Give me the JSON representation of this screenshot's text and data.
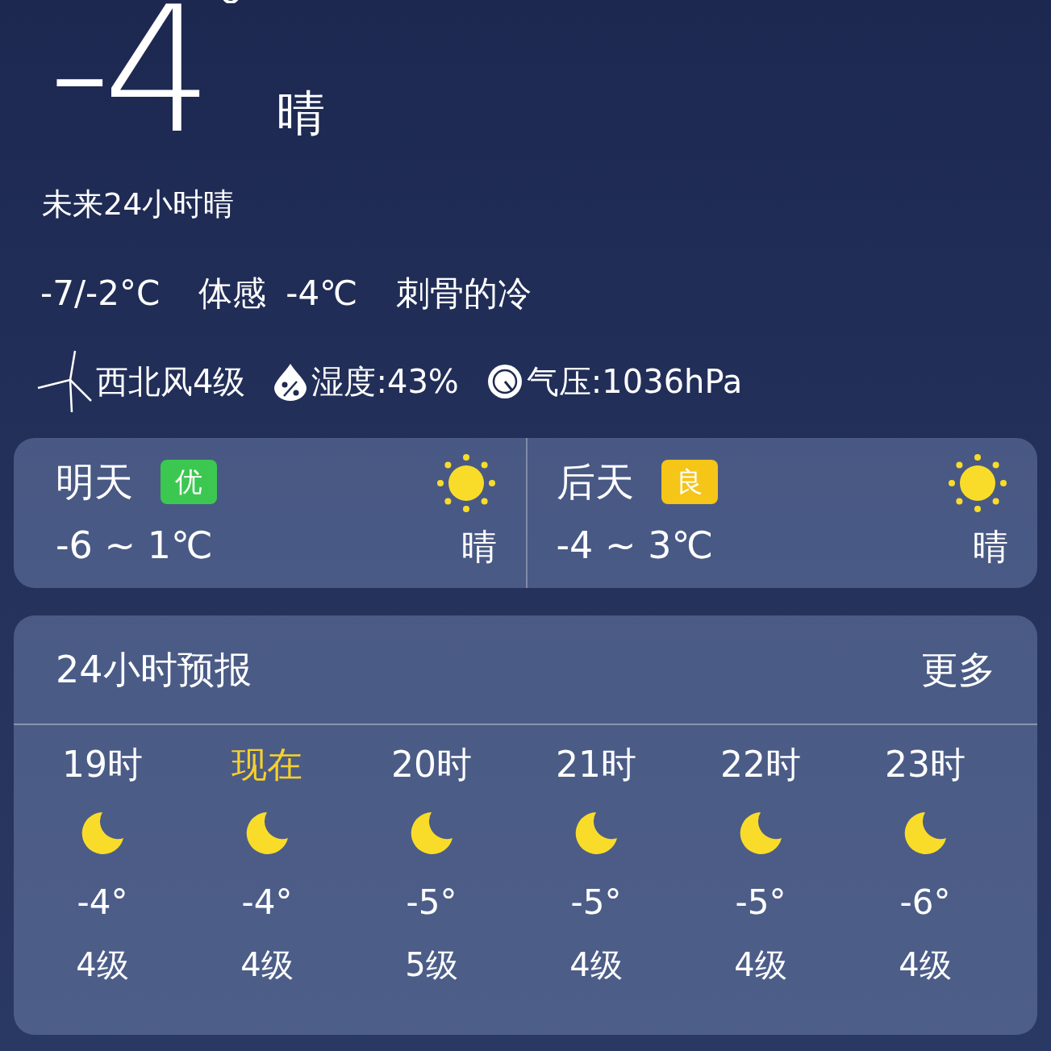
{
  "current": {
    "temperature": "-4",
    "condition": "晴"
  },
  "summary": "未来24小时晴",
  "details": {
    "range": "-7/-2°C",
    "feels_label": "体感",
    "feels_value": "-4℃",
    "feeling": "刺骨的冷"
  },
  "conditions": [
    {
      "kind": "wind",
      "text": "西北风4级"
    },
    {
      "kind": "humidity",
      "text": "湿度:43%"
    },
    {
      "kind": "pressure",
      "text": "气压:1036hPa"
    }
  ],
  "days": [
    {
      "label": "明天",
      "aqi": "优",
      "color": "#3cc850",
      "range": "-6 ~ 1℃",
      "condition": "晴"
    },
    {
      "label": "后天",
      "aqi": "良",
      "color": "#f5c518",
      "range": "-4 ~ 3℃",
      "condition": "晴"
    }
  ],
  "hourly": {
    "title": "24小时预报",
    "more": "更多",
    "hours": [
      {
        "time": "19时",
        "selected": false,
        "temp": "-4°",
        "wind": "4级"
      },
      {
        "time": "现在",
        "selected": true,
        "temp": "-4°",
        "wind": "4级"
      },
      {
        "time": "20时",
        "selected": false,
        "temp": "-5°",
        "wind": "5级"
      },
      {
        "time": "21时",
        "selected": false,
        "temp": "-5°",
        "wind": "4级"
      },
      {
        "time": "22时",
        "selected": false,
        "temp": "-5°",
        "wind": "4级"
      },
      {
        "time": "23时",
        "selected": false,
        "temp": "-6°",
        "wind": "4级"
      }
    ]
  }
}
